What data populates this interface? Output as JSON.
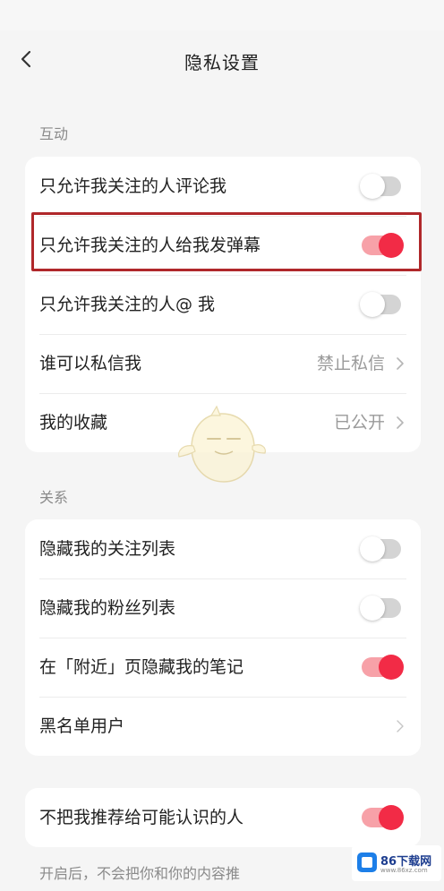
{
  "header": {
    "title": "隐私设置"
  },
  "sections": {
    "interaction": {
      "label": "互动",
      "rows": [
        {
          "label": "只允许我关注的人评论我",
          "toggle": false
        },
        {
          "label": "只允许我关注的人给我发弹幕",
          "toggle": true
        },
        {
          "label": "只允许我关注的人@ 我",
          "toggle": false
        },
        {
          "label": "谁可以私信我",
          "value": "禁止私信"
        },
        {
          "label": "我的收藏",
          "value": "已公开"
        }
      ]
    },
    "relation": {
      "label": "关系",
      "rows": [
        {
          "label": "隐藏我的关注列表",
          "toggle": false
        },
        {
          "label": "隐藏我的粉丝列表",
          "toggle": false
        },
        {
          "label": "在「附近」页隐藏我的笔记",
          "toggle": true
        },
        {
          "label": "黑名单用户"
        }
      ]
    },
    "recommend": {
      "rows": [
        {
          "label": "不把我推荐给可能认识的人",
          "toggle": true
        }
      ],
      "footer": "开启后，不会把你和你的内容推"
    }
  },
  "watermark": {
    "name": "86下载网",
    "url": "www.86xz.com"
  },
  "colors": {
    "accent": "#f22b46",
    "toggle_off": "#d4d4d4",
    "highlight_border": "#b0282b",
    "background": "#f5f5f5"
  }
}
